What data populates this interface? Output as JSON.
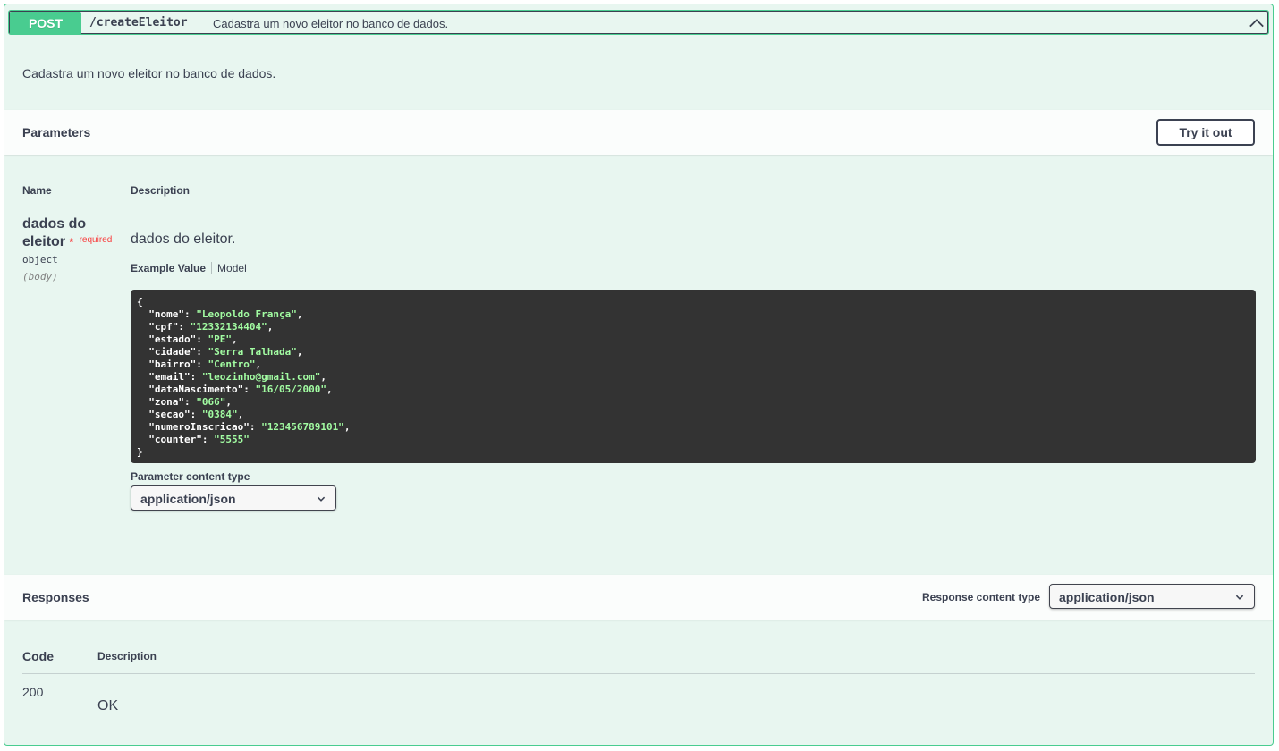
{
  "summary": {
    "method": "POST",
    "path": "/createEleitor",
    "description": "Cadastra um novo eleitor no banco de dados."
  },
  "description": "Cadastra um novo eleitor no banco de dados.",
  "parameters": {
    "title": "Parameters",
    "try_label": "Try it out",
    "col_name": "Name",
    "col_description": "Description",
    "param": {
      "name": "dados do eleitor",
      "required_star": "*",
      "required_label": "required",
      "type": "object",
      "in": "(body)",
      "description": "dados do eleitor.",
      "tab_example": "Example Value",
      "tab_model": "Model"
    },
    "example": {
      "open": "{",
      "close": "}",
      "fields": [
        {
          "key": "\"nome\"",
          "value": "\"Leopoldo França\"",
          "comma": ","
        },
        {
          "key": "\"cpf\"",
          "value": "\"12332134404\"",
          "comma": ","
        },
        {
          "key": "\"estado\"",
          "value": "\"PE\"",
          "comma": ","
        },
        {
          "key": "\"cidade\"",
          "value": "\"Serra Talhada\"",
          "comma": ","
        },
        {
          "key": "\"bairro\"",
          "value": "\"Centro\"",
          "comma": ","
        },
        {
          "key": "\"email\"",
          "value": "\"leozinho@gmail.com\"",
          "comma": ","
        },
        {
          "key": "\"dataNascimento\"",
          "value": "\"16/05/2000\"",
          "comma": ","
        },
        {
          "key": "\"zona\"",
          "value": "\"066\"",
          "comma": ","
        },
        {
          "key": "\"secao\"",
          "value": "\"0384\"",
          "comma": ","
        },
        {
          "key": "\"numeroInscricao\"",
          "value": "\"123456789101\"",
          "comma": ","
        },
        {
          "key": "\"counter\"",
          "value": "\"5555\"",
          "comma": ""
        }
      ]
    },
    "content_type_label": "Parameter content type",
    "content_type_value": "application/json"
  },
  "responses": {
    "title": "Responses",
    "content_type_label": "Response content type",
    "content_type_value": "application/json",
    "col_code": "Code",
    "col_description": "Description",
    "rows": [
      {
        "code": "200",
        "description": "OK"
      }
    ]
  },
  "colors": {
    "post_green": "#49cc90",
    "post_bg": "#e8f6f0",
    "text": "#3b4151",
    "code_bg": "#333333",
    "code_string": "#a2fca2",
    "required": "#f93e3e"
  }
}
